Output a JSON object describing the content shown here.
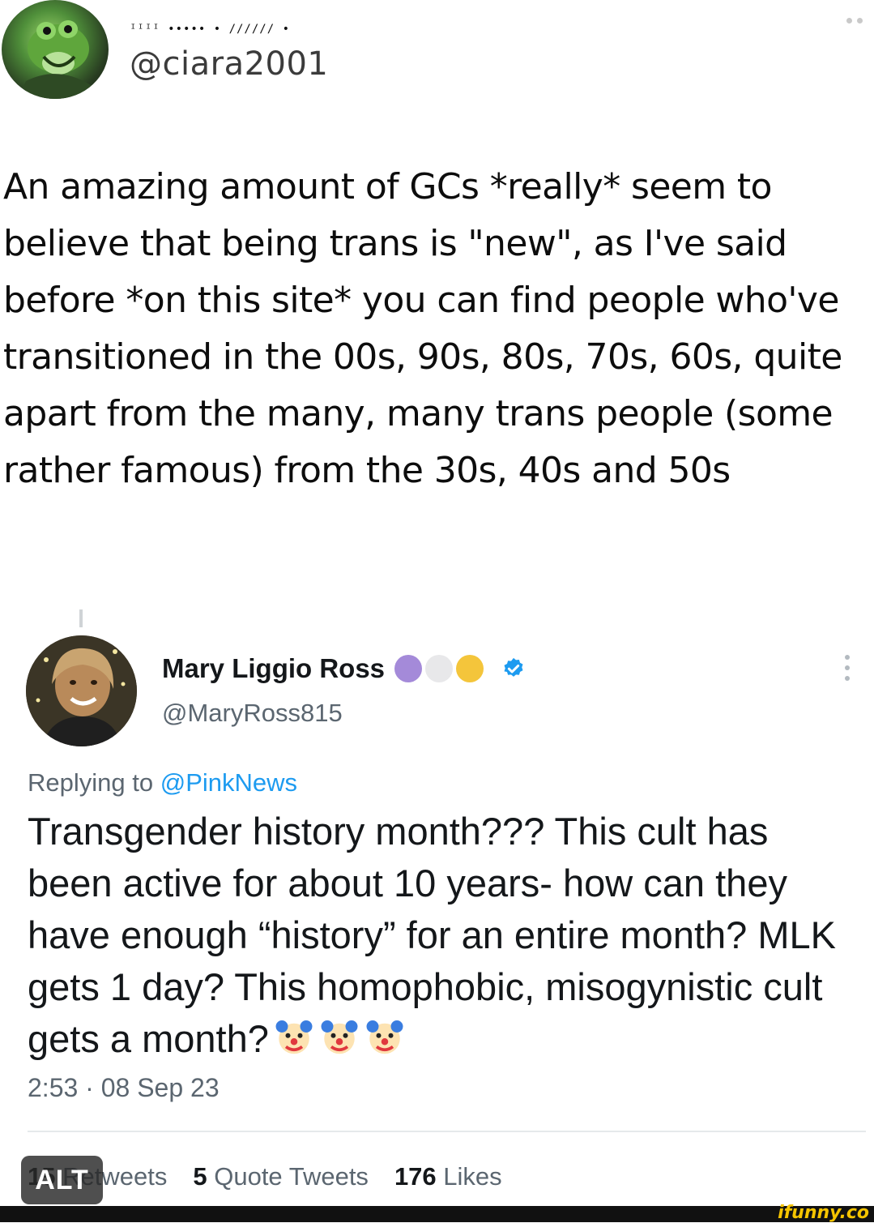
{
  "top_post": {
    "display_name_deco": "ᴵᴵᴵᴵ ••••• • ////// •",
    "handle": "@ciara2001",
    "text": "An amazing amount of GCs *really* seem to believe that being trans is \"new\", as I've said before *on this site* you can find people who've transitioned in the 00s, 90s, 80s, 70s, 60s, quite apart from the many, many trans people (some rather famous) from the 30s, 40s and 50s",
    "more_icon": "more-dots-icon"
  },
  "reply_tweet": {
    "name": "Mary Liggio Ross",
    "handle": "@MaryRoss815",
    "name_dots": [
      "#a48ad9",
      "#e8e8ea",
      "#f4c53b"
    ],
    "replying_prefix": "Replying to ",
    "replying_to": "@PinkNews",
    "text": "Transgender history month??? This cult has been active for about 10 years- how can they have enough “history” for an entire month? MLK gets 1 day? This homophobic, misogynistic cult gets a month?",
    "emojis": [
      "clown-icon",
      "clown-icon",
      "clown-icon"
    ],
    "timestamp": "2:53 · 08 Sep 23",
    "stats": {
      "retweets_count": "15",
      "retweets_label": "Retweets",
      "quotes_count": "5",
      "quotes_label": "Quote Tweets",
      "likes_count": "176",
      "likes_label": "Likes"
    }
  },
  "alt_badge": "ALT",
  "watermark": "ifunny.co",
  "colors": {
    "link": "#1d9bf0",
    "secondary_text": "#5b6670",
    "verified": "#1d9bf0"
  }
}
